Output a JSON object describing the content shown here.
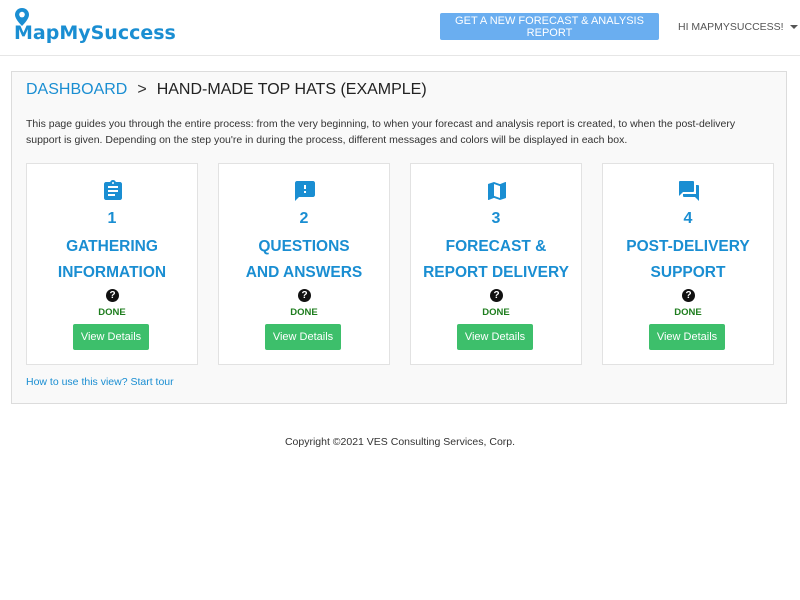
{
  "header": {
    "logo_text": "MapMySuccess",
    "cta_label": "GET A NEW FORECAST & ANALYSIS REPORT",
    "user_label": "HI MAPMYSUCCESS!"
  },
  "breadcrumb": {
    "root": "DASHBOARD",
    "separator": ">",
    "current": "HAND-MADE TOP HATS (EXAMPLE)"
  },
  "intro": "This page guides you through the entire process: from the very beginning, to when your forecast and analysis report is created, to when the post-delivery support is given. Depending on the step you're in during the process, different messages and colors will be displayed in each box.",
  "steps": [
    {
      "number": "1",
      "title_line1": "GATHERING",
      "title_line2": "INFORMATION",
      "icon": "clipboard-icon",
      "help": "?",
      "status": "DONE",
      "button": "View Details"
    },
    {
      "number": "2",
      "title_line1": "QUESTIONS",
      "title_line2": "AND ANSWERS",
      "icon": "chat-alert-icon",
      "help": "?",
      "status": "DONE",
      "button": "View Details"
    },
    {
      "number": "3",
      "title_line1": "FORECAST &",
      "title_line2": "REPORT DELIVERY",
      "icon": "map-icon",
      "help": "?",
      "status": "DONE",
      "button": "View Details"
    },
    {
      "number": "4",
      "title_line1": "POST-DELIVERY",
      "title_line2": "SUPPORT",
      "icon": "forum-icon",
      "help": "?",
      "status": "DONE",
      "button": "View Details"
    }
  ],
  "tour_link": "How to use this view? Start tour",
  "footer": "Copyright ©2021 VES Consulting Services, Corp.",
  "colors": {
    "brand": "#1a8ed2",
    "cta": "#6aaef0",
    "done": "#1e7d1e",
    "details_button": "#3dbf6b"
  }
}
